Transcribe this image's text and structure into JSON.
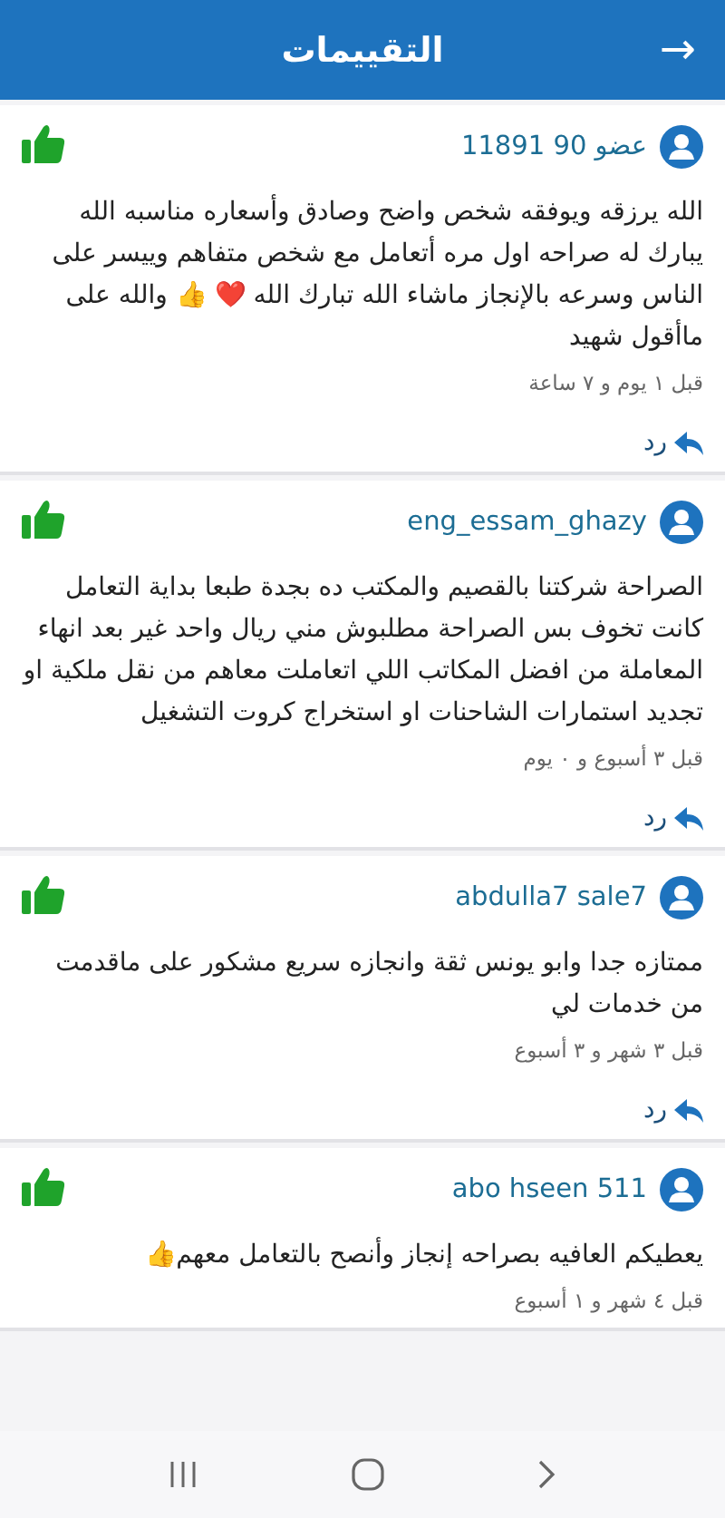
{
  "header": {
    "title": "التقييمات",
    "back": "→"
  },
  "reviews": [
    {
      "user": "عضو 90 11891",
      "liked": true,
      "text": "الله يرزقه ويوفقه شخص واضح وصادق وأسعاره مناسبه الله يبارك له صراحه اول مره أتعامل مع شخص متفاهم وييسر على الناس وسرعه بالإنجاز ماشاء الله تبارك الله ❤️ 👍 والله على ماأقول شهيد",
      "time": "قبل ١ يوم و ٧ ساعة",
      "reply": "رد"
    },
    {
      "user": "eng_essam_ghazy",
      "liked": true,
      "text": "الصراحة شركتنا بالقصيم والمكتب ده بجدة طبعا بداية التعامل كانت تخوف بس الصراحة مطلبوش مني ريال واحد غير بعد انهاء المعاملة من افضل المكاتب اللي اتعاملت معاهم من نقل ملكية او تجديد استمارات الشاحنات او استخراج كروت التشغيل",
      "time": "قبل ٣ أسبوع و ٠ يوم",
      "reply": "رد"
    },
    {
      "user": "abdulla7 sale7",
      "liked": true,
      "text": "ممتازه جدا  وابو يونس ثقة وانجازه سريع مشكور على ماقدمت من خدمات لي",
      "time": "قبل ٣ شهر و ٣ أسبوع",
      "reply": "رد"
    },
    {
      "user": "abo hseen 511",
      "liked": true,
      "text": "يعطيكم العافيه بصراحه إنجاز وأنصح بالتعامل معهم👍",
      "time": "قبل ٤ شهر و ١ أسبوع"
    }
  ]
}
